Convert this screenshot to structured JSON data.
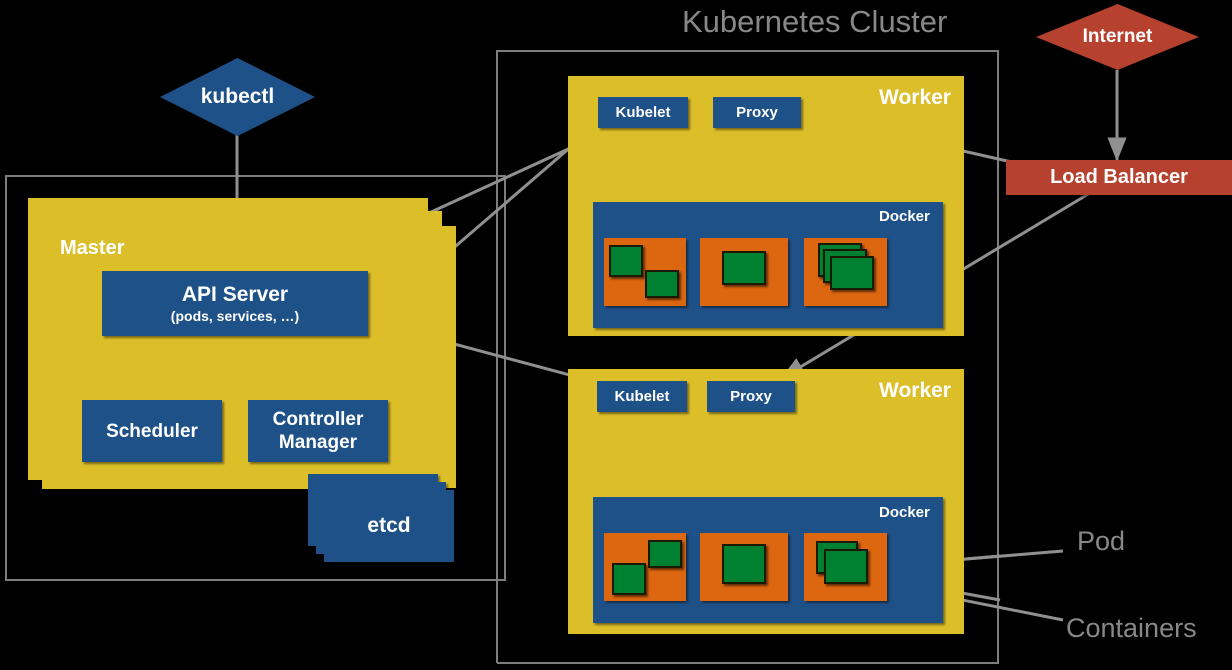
{
  "diagram": {
    "title": "Kubernetes Cluster",
    "callouts": {
      "pod": "Pod",
      "containers": "Containers"
    },
    "external": {
      "kubectl": "kubectl",
      "internet": "Internet",
      "load_balancer": "Load Balancer"
    },
    "master": {
      "label": "Master",
      "api_server": {
        "title": "API Server",
        "subtitle": "(pods, services, …)"
      },
      "scheduler": "Scheduler",
      "controller_manager_line1": "Controller",
      "controller_manager_line2": "Manager",
      "etcd": "etcd"
    },
    "workers": [
      {
        "label": "Worker",
        "kubelet": "Kubelet",
        "proxy": "Proxy",
        "docker": "Docker"
      },
      {
        "label": "Worker",
        "kubelet": "Kubelet",
        "proxy": "Proxy",
        "docker": "Docker"
      }
    ],
    "colors": {
      "background": "#000000",
      "node_yellow": "#DCBE28",
      "component_blue": "#1F5189",
      "pod_orange": "#DD6611",
      "container_green": "#008031",
      "external_red": "#B5412E",
      "outline_gray": "#808080",
      "callout_text": "#888888"
    }
  }
}
